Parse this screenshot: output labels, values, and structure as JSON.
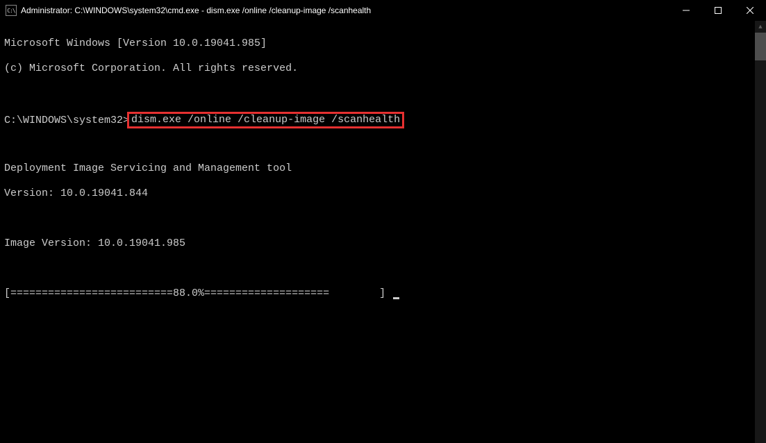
{
  "titlebar": {
    "icon_text": "C:\\",
    "title": "Administrator: C:\\WINDOWS\\system32\\cmd.exe - dism.exe  /online /cleanup-image /scanhealth"
  },
  "terminal": {
    "line1": "Microsoft Windows [Version 10.0.19041.985]",
    "line2": "(c) Microsoft Corporation. All rights reserved.",
    "prompt": "C:\\WINDOWS\\system32>",
    "highlighted_command": "dism.exe /online /cleanup-image /scanhealth",
    "tool_line1": "Deployment Image Servicing and Management tool",
    "tool_line2": "Version: 10.0.19041.844",
    "image_version": "Image Version: 10.0.19041.985",
    "progress_line": "[==========================88.0%====================        ] "
  }
}
